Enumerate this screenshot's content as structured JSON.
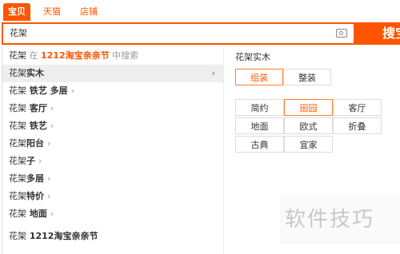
{
  "tabs": [
    {
      "label": "宝贝",
      "active": true
    },
    {
      "label": "天猫",
      "active": false
    },
    {
      "label": "店铺",
      "active": false
    }
  ],
  "search": {
    "value": "花架",
    "button_label": "搜宝",
    "camera_icon": "camera-icon"
  },
  "suggestions": [
    {
      "kw": "花架",
      "bold": "",
      "pre": " 在 ",
      "event": "1212淘宝亲亲节",
      "post": " 中搜索"
    },
    {
      "kw": "花架",
      "bold": "实木",
      "active": true,
      "arrow_right": true
    },
    {
      "kw": "花架",
      "bold": " 铁艺 多层",
      "chev": true
    },
    {
      "kw": "花架",
      "bold": " 客厅",
      "chev": true
    },
    {
      "kw": "花架",
      "bold": " 铁艺",
      "chev": true
    },
    {
      "kw": "花架",
      "bold": "阳台",
      "chev": true
    },
    {
      "kw": "花架",
      "bold": "子",
      "chev": true
    },
    {
      "kw": "花架",
      "bold": "多层",
      "chev": true
    },
    {
      "kw": "花架",
      "bold": "特价",
      "chev": true
    },
    {
      "kw": "花架",
      "bold": " 地面",
      "chev": true
    },
    {
      "kw": "花架",
      "bold": " 1212淘宝亲亲节"
    }
  ],
  "panel": {
    "title": "花架实木",
    "type_options": [
      {
        "label": "组装",
        "selected": true
      },
      {
        "label": "整装",
        "selected": false
      }
    ],
    "style_options": [
      {
        "label": "简约",
        "selected": false
      },
      {
        "label": "田园",
        "selected": true
      },
      {
        "label": "客厅",
        "selected": false
      },
      {
        "label": "地面",
        "selected": false
      },
      {
        "label": "欧式",
        "selected": false
      },
      {
        "label": "折叠",
        "selected": false
      },
      {
        "label": "古典",
        "selected": false
      },
      {
        "label": "宜家",
        "selected": false
      }
    ]
  },
  "watermark": "软件技巧",
  "colors": {
    "accent": "#ff5500",
    "selected_border": "#ff7f33",
    "row_highlight": "#eeeeee"
  }
}
